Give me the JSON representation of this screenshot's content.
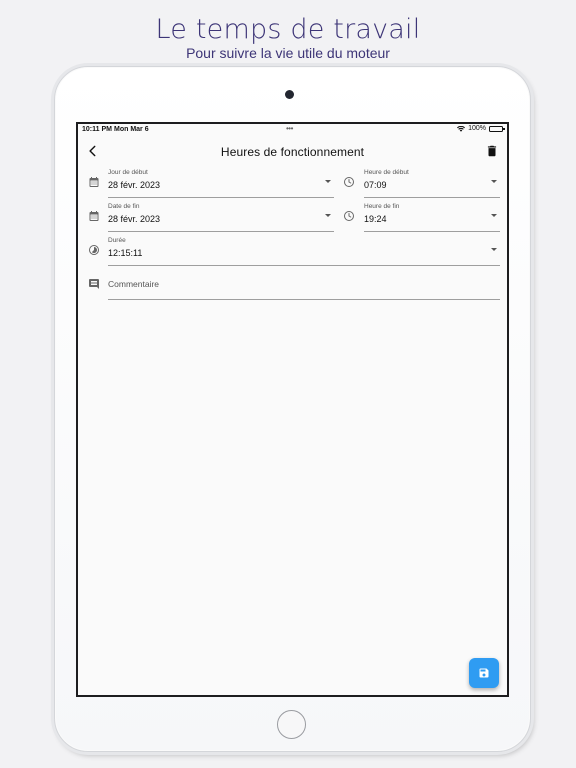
{
  "promo": {
    "headline": "Le temps de travail",
    "subline": "Pour suivre la vie utile du moteur"
  },
  "status_bar": {
    "time": "10:11 PM",
    "date": "Mon Mar 6",
    "dots": "•••",
    "battery": "100%"
  },
  "app_bar": {
    "title": "Heures de fonctionnement",
    "back_icon": "chevron-left-icon",
    "delete_icon": "trash-icon"
  },
  "form": {
    "start_date": {
      "label": "Jour de début",
      "value": "28 févr. 2023",
      "icon": "calendar-icon"
    },
    "start_time": {
      "label": "Heure de début",
      "value": "07:09",
      "icon": "clock-icon"
    },
    "end_date": {
      "label": "Date de fin",
      "value": "28 févr. 2023",
      "icon": "calendar-icon"
    },
    "end_time": {
      "label": "Heure de fin",
      "value": "19:24",
      "icon": "clock-icon"
    },
    "duration": {
      "label": "Durée",
      "value": "12:15:11",
      "icon": "timelapse-icon"
    },
    "comment": {
      "placeholder": "Commentaire",
      "value": "",
      "icon": "comment-icon"
    }
  },
  "fab": {
    "icon": "save-icon",
    "color": "#2f9cf2"
  },
  "colors": {
    "accent": "#2f9cf2",
    "headline": "#3d3577"
  }
}
